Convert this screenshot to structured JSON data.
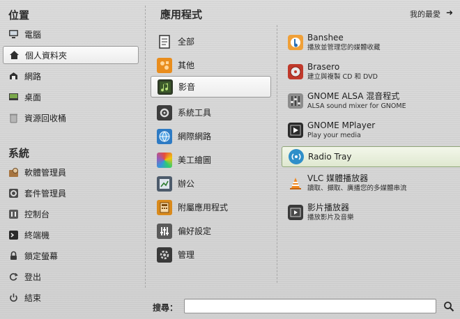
{
  "places": {
    "title": "位置",
    "items": [
      {
        "label": "電腦",
        "icon": "computer-icon"
      },
      {
        "label": "個人資料夾",
        "icon": "home-icon"
      },
      {
        "label": "網路",
        "icon": "network-icon"
      },
      {
        "label": "桌面",
        "icon": "desktop-icon"
      },
      {
        "label": "資源回收桶",
        "icon": "trash-icon"
      }
    ]
  },
  "system": {
    "title": "系統",
    "items": [
      {
        "label": "軟體管理員",
        "icon": "software-manager-icon"
      },
      {
        "label": "套件管理員",
        "icon": "package-manager-icon"
      },
      {
        "label": "控制台",
        "icon": "control-center-icon"
      },
      {
        "label": "終端機",
        "icon": "terminal-icon"
      },
      {
        "label": "鎖定螢幕",
        "icon": "lock-icon"
      },
      {
        "label": "登出",
        "icon": "logout-icon"
      },
      {
        "label": "結束",
        "icon": "power-icon"
      }
    ]
  },
  "applications": {
    "title": "應用程式",
    "favorites_label": "我的最愛",
    "categories": [
      {
        "label": "全部"
      },
      {
        "label": "其他"
      },
      {
        "label": "影音"
      },
      {
        "label": "系統工具"
      },
      {
        "label": "網際網路"
      },
      {
        "label": "美工繪圖"
      },
      {
        "label": "辦公"
      },
      {
        "label": "附屬應用程式"
      },
      {
        "label": "偏好設定"
      },
      {
        "label": "管理"
      }
    ],
    "apps": [
      {
        "name": "Banshee",
        "desc": "播放並管理您的媒體收藏"
      },
      {
        "name": "Brasero",
        "desc": "建立與複製 CD 和 DVD"
      },
      {
        "name": "GNOME ALSA 混音程式",
        "desc": "ALSA sound mixer for GNOME"
      },
      {
        "name": "GNOME MPlayer",
        "desc": "Play your media"
      },
      {
        "name": "Radio Tray",
        "desc": ""
      },
      {
        "name": "VLC 媒體播放器",
        "desc": "讀取、擷取、廣播您的多媒體串流"
      },
      {
        "name": "影片播放器",
        "desc": "播放影片及音樂"
      }
    ]
  },
  "search": {
    "label": "搜尋：",
    "value": "",
    "placeholder": ""
  }
}
